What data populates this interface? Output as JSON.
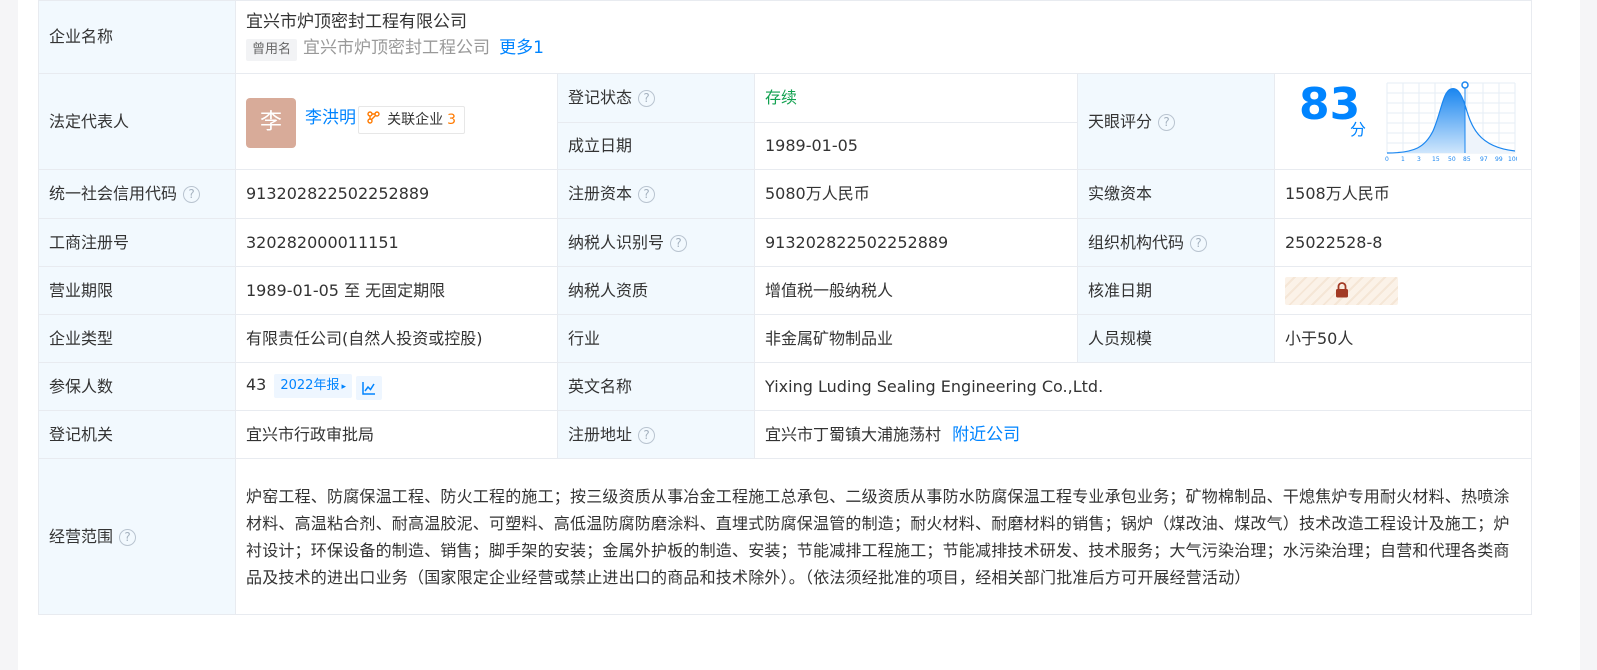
{
  "company": {
    "name_label": "企业名称",
    "name": "宜兴市炉顶密封工程有限公司",
    "used_name_tag": "曾用名",
    "used_name": "宜兴市炉顶密封工程公司",
    "more_link": "更多1"
  },
  "legal_rep": {
    "label": "法定代表人",
    "avatar_char": "李",
    "name": "李洪明",
    "related_label": "关联企业",
    "related_count": "3"
  },
  "reg_status": {
    "label": "登记状态",
    "value": "存续",
    "color": "#12a150"
  },
  "found_date": {
    "label": "成立日期",
    "value": "1989-01-05"
  },
  "score": {
    "label": "天眼评分",
    "value": "83",
    "unit": "分",
    "axis_ticks": [
      "0",
      "1",
      "3",
      "15",
      "50",
      "85",
      "97",
      "99",
      "100"
    ]
  },
  "credit_code": {
    "label": "统一社会信用代码",
    "value": "913202822502252889"
  },
  "reg_capital": {
    "label": "注册资本",
    "value": "5080万人民币"
  },
  "paid_capital": {
    "label": "实缴资本",
    "value": "1508万人民币"
  },
  "biz_reg_no": {
    "label": "工商注册号",
    "value": "320282000011151"
  },
  "taxpayer_id": {
    "label": "纳税人识别号",
    "value": "913202822502252889"
  },
  "org_code": {
    "label": "组织机构代码",
    "value": "25022528-8"
  },
  "biz_term": {
    "label": "营业期限",
    "value": "1989-01-05 至 无固定期限"
  },
  "taxpayer_qual": {
    "label": "纳税人资质",
    "value": "增值税一般纳税人"
  },
  "approval_date": {
    "label": "核准日期",
    "icon": "lock-icon"
  },
  "company_type": {
    "label": "企业类型",
    "value": "有限责任公司(自然人投资或控股)"
  },
  "industry": {
    "label": "行业",
    "value": "非金属矿物制品业"
  },
  "staff_size": {
    "label": "人员规模",
    "value": "小于50人"
  },
  "insured": {
    "label": "参保人数",
    "value": "43",
    "year_tag": "2022年报",
    "chart_icon": "trend-chart-icon"
  },
  "english_name": {
    "label": "英文名称",
    "value": "Yixing Luding Sealing Engineering Co.,Ltd."
  },
  "reg_authority": {
    "label": "登记机关",
    "value": "宜兴市行政审批局"
  },
  "reg_address": {
    "label": "注册地址",
    "value": "宜兴市丁蜀镇大浦施荡村",
    "nearby_link": "附近公司"
  },
  "biz_scope": {
    "label": "经营范围",
    "value": "炉窑工程、防腐保温工程、防火工程的施工；按三级资质从事冶金工程施工总承包、二级资质从事防水防腐保温工程专业承包业务；矿物棉制品、干熄焦炉专用耐火材料、热喷涂材料、高温粘合剂、耐高温胶泥、可塑料、高低温防腐防磨涂料、直埋式防腐保温管的制造；耐火材料、耐磨材料的销售；锅炉（煤改油、煤改气）技术改造工程设计及施工；炉衬设计；环保设备的制造、销售；脚手架的安装；金属外护板的制造、安装；节能减排工程施工；节能减排技术研发、技术服务；大气污染治理；水污染治理；自营和代理各类商品及技术的进出口业务（国家限定企业经营或禁止进出口的商品和技术除外）。（依法须经批准的项目，经相关部门批准后方可开展经营活动）"
  },
  "help_icon": "help-circle-icon",
  "colors": {
    "label_bg": "#f2f9fe",
    "link": "#0084ff",
    "border": "#e8ebf0"
  }
}
